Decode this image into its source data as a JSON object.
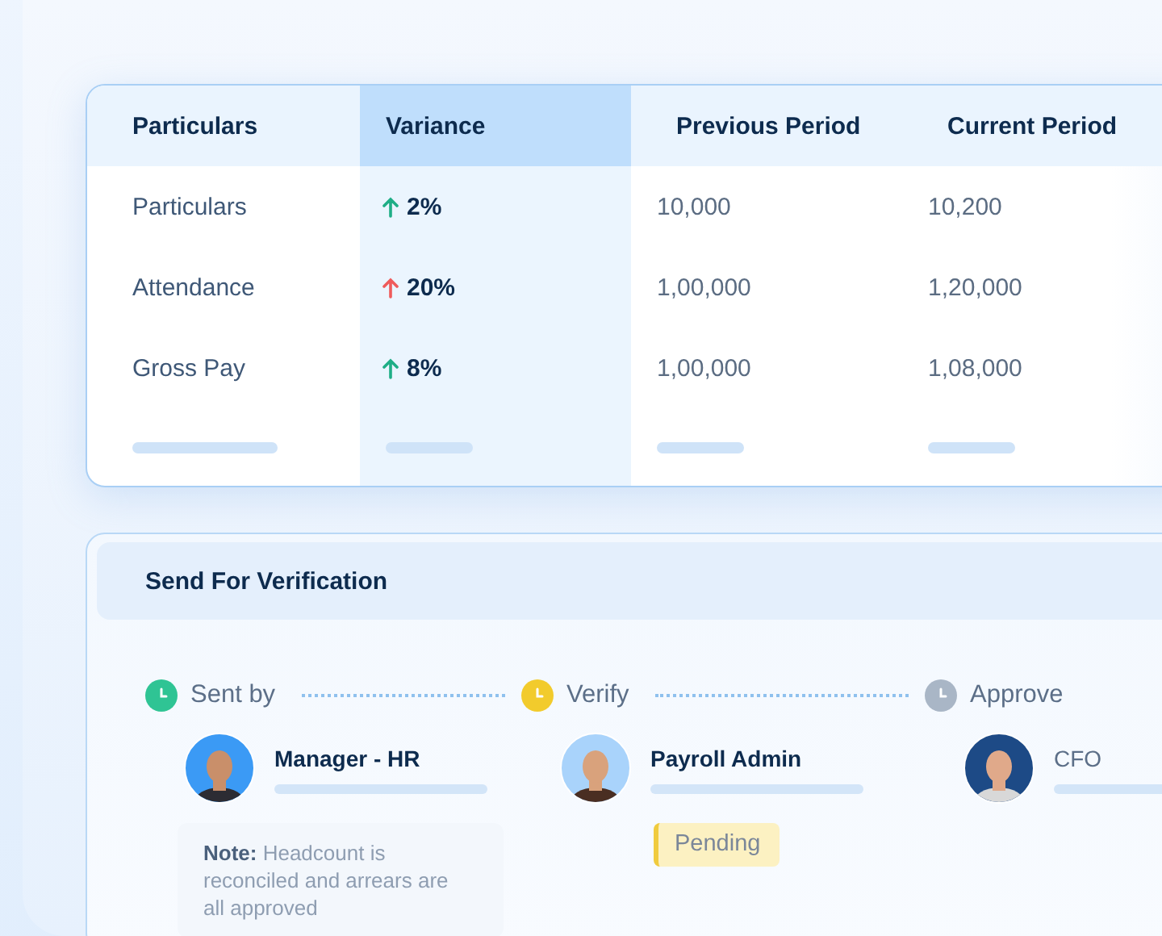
{
  "table": {
    "columns": [
      "Particulars",
      "Variance",
      "Previous Period",
      "Current Period"
    ],
    "rows": [
      {
        "particular": "Particulars",
        "variance": "2%",
        "color": "#1fae86",
        "previous": "10,000",
        "current": "10,200"
      },
      {
        "particular": "Attendance",
        "variance": "20%",
        "color": "#ef5b5b",
        "previous": "1,00,000",
        "current": "1,20,000"
      },
      {
        "particular": "Gross Pay",
        "variance": "8%",
        "color": "#1fae86",
        "previous": "1,00,000",
        "current": "1,08,000"
      }
    ]
  },
  "verification": {
    "title": "Send For Verification",
    "steps": [
      {
        "label": "Sent by",
        "color": "#2fc494",
        "person": "Manager - HR",
        "note": "**Note:** Headcount is reconciled and arrears are all approved"
      },
      {
        "label": "Verify",
        "color": "#f2cb2c",
        "person": "Payroll Admin",
        "badge": "Pending"
      },
      {
        "label": "Approve",
        "color": "#a9b6c6",
        "person": "CFO"
      }
    ]
  }
}
